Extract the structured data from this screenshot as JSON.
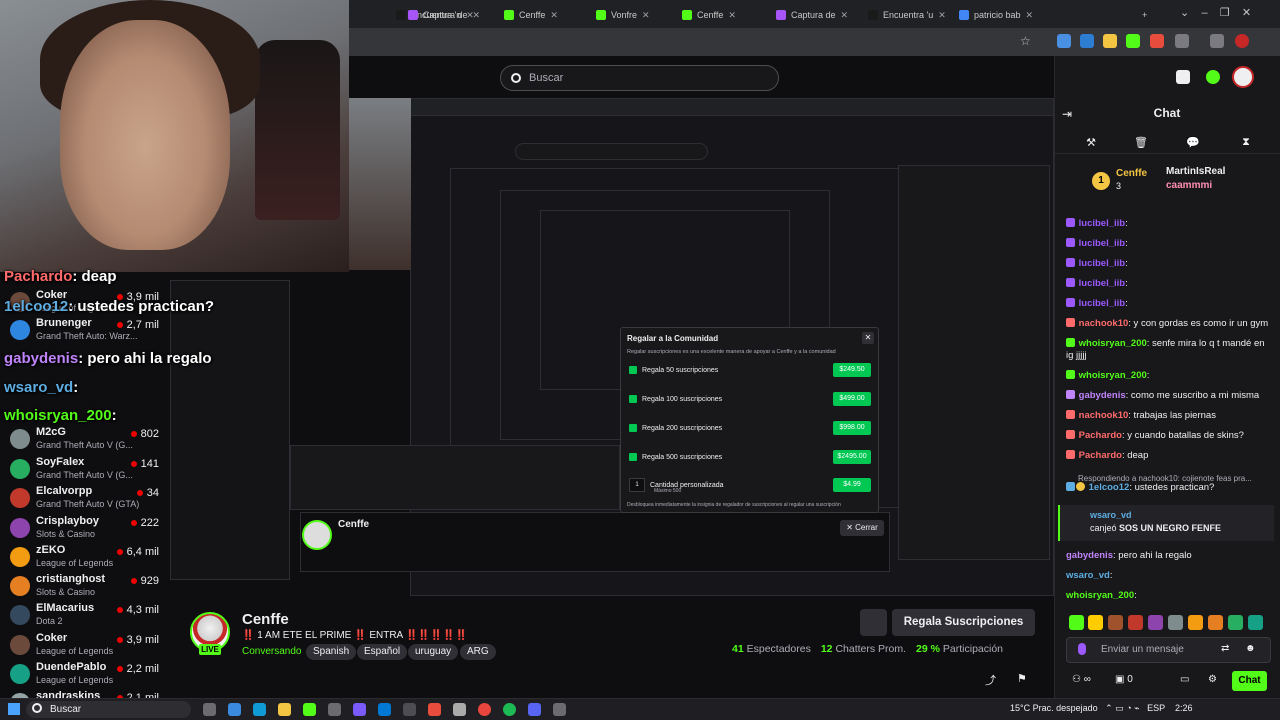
{
  "browser": {
    "tabs": [
      {
        "label": "Encuentra 'n",
        "color": "#1a1a1a"
      },
      {
        "label": "Captura de",
        "color": "#a855f7"
      },
      {
        "label": "Cenffe",
        "color": "#53fc18"
      },
      {
        "label": "Vonfre",
        "color": "#53fc18"
      },
      {
        "label": "Cenffe",
        "color": "#53fc18"
      },
      {
        "label": "Captura de",
        "color": "#a855f7"
      },
      {
        "label": "Encuentra 'u",
        "color": "#1a1a1a"
      },
      {
        "label": "patricio bab",
        "color": "#4285f4"
      }
    ],
    "new_tab": "+"
  },
  "search": {
    "placeholder": "Buscar"
  },
  "overlay_chat": [
    {
      "user": "Pachardo",
      "text": ": deap"
    },
    {
      "user": "1elcoo12",
      "text": ": ustedes practican?"
    },
    {
      "user": "gabydenis",
      "text": ": pero ahi la regalo"
    },
    {
      "user": "wsaro_vd",
      "text": ":"
    },
    {
      "user": "whoisryan_200",
      "text": ":"
    }
  ],
  "sidebar": {
    "channels": [
      {
        "name": "Coker",
        "game": "League of Legends",
        "viewers": "3,9 mil"
      },
      {
        "name": "Brunenger",
        "game": "Grand Theft Auto: Warz...",
        "viewers": "2,7 mil"
      },
      {
        "name": "M2cG",
        "game": "Grand Theft Auto V (G...",
        "viewers": "802"
      },
      {
        "name": "SoyFalex",
        "game": "Grand Theft Auto V (G...",
        "viewers": "141"
      },
      {
        "name": "Elcalvorpp",
        "game": "Grand Theft Auto V (GTA)",
        "viewers": "34"
      },
      {
        "name": "Crisplayboy",
        "game": "Slots & Casino",
        "viewers": "222"
      },
      {
        "name": "zEKO",
        "game": "League of Legends",
        "viewers": "6,4 mil"
      },
      {
        "name": "cristianghost",
        "game": "Slots & Casino",
        "viewers": "929"
      },
      {
        "name": "ElMacarius",
        "game": "Dota 2",
        "viewers": "4,3 mil"
      },
      {
        "name": "Coker",
        "game": "League of Legends",
        "viewers": "3,9 mil"
      },
      {
        "name": "DuendePablo",
        "game": "League of Legends",
        "viewers": "2,2 mil"
      },
      {
        "name": "sandraskins",
        "game": "",
        "viewers": "2,1 mil"
      }
    ]
  },
  "modal": {
    "title": "Regalar a la Comunidad",
    "subtitle": "Regalar suscripciones es una excelente manera de apoyar a Cenffe y a la comunidad",
    "options": [
      {
        "label": "Regala 50 suscripciones",
        "price": "$249.50"
      },
      {
        "label": "Regala 100 suscripciones",
        "price": "$499.00"
      },
      {
        "label": "Regala 200 suscripciones",
        "price": "$998.00"
      },
      {
        "label": "Regala 500 suscripciones",
        "price": "$2495.00"
      },
      {
        "label": "Cantidad personalizada",
        "price": "$4.99"
      }
    ],
    "custom_qty": "1",
    "custom_max": "Máximo 500",
    "footer": "Desbloquea inmediatamente la insignia de regalador de suscripciones al regalar una suscripción"
  },
  "stream": {
    "name": "Cenffe",
    "title": "‼️ 1 AM ETE EL PRIME ‼️ ENTRA ‼️‼️‼️‼️‼️",
    "status": "Conversando",
    "tags": [
      "Spanish",
      "Español",
      "uruguay",
      "ARG"
    ],
    "live": "LIVE",
    "viewers": "41",
    "viewers_label": "Espectadores",
    "chatters": "12",
    "chatters_label": "Chatters Prom.",
    "participation": "29 %",
    "participation_label": "Participación",
    "gift_button": "Regala Suscripciones"
  },
  "chat": {
    "title": "Chat",
    "pinned": {
      "user1": "Cenffe",
      "user1_count": "3",
      "user2": "MartinIsReal",
      "user3": "caammmi",
      "rank": "1"
    },
    "messages": [
      {
        "user": "lucibel_iib",
        "text": ":",
        "color": "#9b59ff"
      },
      {
        "user": "lucibel_iib",
        "text": ":",
        "color": "#9b59ff"
      },
      {
        "user": "lucibel_iib",
        "text": ":",
        "color": "#9b59ff"
      },
      {
        "user": "lucibel_iib",
        "text": ":",
        "color": "#9b59ff"
      },
      {
        "user": "lucibel_iib",
        "text": ":",
        "color": "#9b59ff"
      },
      {
        "user": "nachook10",
        "text": ": y con gordas es como ir un gym",
        "color": "#ff6b6b"
      },
      {
        "user": "whoisryan_200",
        "text": ": senfe mira lo q t mandé en ig jjjjj",
        "color": "#53fc18"
      },
      {
        "user": "whoisryan_200",
        "text": ":",
        "color": "#53fc18"
      },
      {
        "user": "gabydenis",
        "text": ": como me suscribo a mi misma",
        "color": "#c084fc"
      },
      {
        "user": "nachook10",
        "text": ": trabajas las piernas",
        "color": "#ff6b6b"
      },
      {
        "user": "Pachardo",
        "text": ": y cuando batallas de skins?",
        "color": "#ff6b6b"
      },
      {
        "user": "Pachardo",
        "text": ": deap",
        "color": "#ff6b6b"
      }
    ],
    "reply_hint": "Respondiendo a nachook10: cojienote feas pra...",
    "reply_msg": {
      "user": "1elcoo12",
      "text": ": ustedes practican?",
      "color": "#5dade2"
    },
    "system_user": "wsaro_vd",
    "system_text_a": "canjeó",
    "system_text_b": "SOS UN NEGRO FENFE",
    "after": [
      {
        "user": "gabydenis",
        "text": ": pero ahi la regalo",
        "color": "#c084fc"
      },
      {
        "user": "wsaro_vd",
        "text": ":",
        "color": "#5dade2"
      },
      {
        "user": "whoisryan_200",
        "text": ":",
        "color": "#53fc18"
      }
    ],
    "input_placeholder": "Enviar un mensaje",
    "send_button": "Chat",
    "count": "0"
  },
  "taskbar": {
    "search": "Buscar",
    "weather": "15°C",
    "weather_text": "Prac. despejado",
    "lang": "ESP",
    "time": "2:26"
  }
}
